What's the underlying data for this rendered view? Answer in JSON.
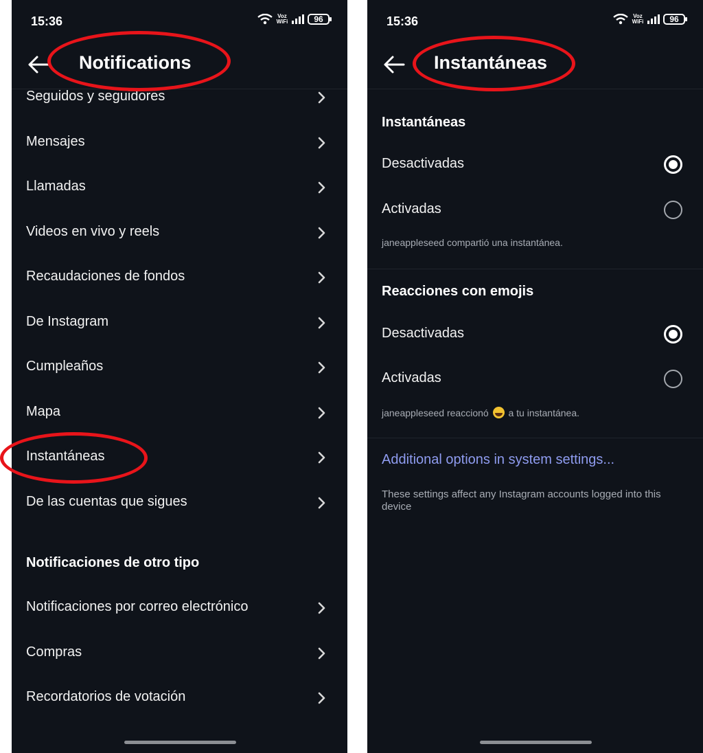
{
  "left_screen": {
    "status": {
      "time": "15:36",
      "voz_wifi": "Voz WiFi",
      "battery": "96"
    },
    "header": {
      "title": "Notifications"
    },
    "menu_items": [
      {
        "label": "Seguidos y seguidores"
      },
      {
        "label": "Mensajes"
      },
      {
        "label": "Llamadas"
      },
      {
        "label": "Videos en vivo y reels"
      },
      {
        "label": "Recaudaciones de fondos"
      },
      {
        "label": "De Instagram"
      },
      {
        "label": "Cumpleaños"
      },
      {
        "label": "Mapa"
      },
      {
        "label": "Instantáneas"
      },
      {
        "label": "De las cuentas que sigues"
      }
    ],
    "other_section": {
      "heading": "Notificaciones de otro tipo",
      "items": [
        {
          "label": "Notificaciones por correo electrónico"
        },
        {
          "label": "Compras"
        },
        {
          "label": "Recordatorios de votación"
        }
      ]
    }
  },
  "right_screen": {
    "status": {
      "time": "15:36",
      "voz_wifi": "Voz WiFi",
      "battery": "96"
    },
    "header": {
      "title": "Instantáneas"
    },
    "sections": [
      {
        "heading": "Instantáneas",
        "options": [
          {
            "label": "Desactivadas",
            "selected": true
          },
          {
            "label": "Activadas",
            "selected": false
          }
        ],
        "caption": "janeappleseed compartió una instantánea."
      },
      {
        "heading": "Reacciones con emojis",
        "options": [
          {
            "label": "Desactivadas",
            "selected": true
          },
          {
            "label": "Activadas",
            "selected": false
          }
        ],
        "caption_before": "janeappleseed reaccionó",
        "caption_after": "a tu instantánea."
      }
    ],
    "link": "Additional options in system settings...",
    "footnote": "These settings affect any Instagram accounts logged into this device"
  },
  "colors": {
    "background": "#0f131a",
    "text": "#f2f2f2",
    "secondary_text": "#a8adb5",
    "link": "#8f9cf0",
    "annotation": "#e8141a"
  },
  "icons": [
    "back-arrow-icon",
    "chevron-right-icon",
    "radio-selected-icon",
    "radio-unselected-icon",
    "wifi-icon",
    "signal-icon",
    "battery-icon",
    "laughing-emoji-icon"
  ]
}
